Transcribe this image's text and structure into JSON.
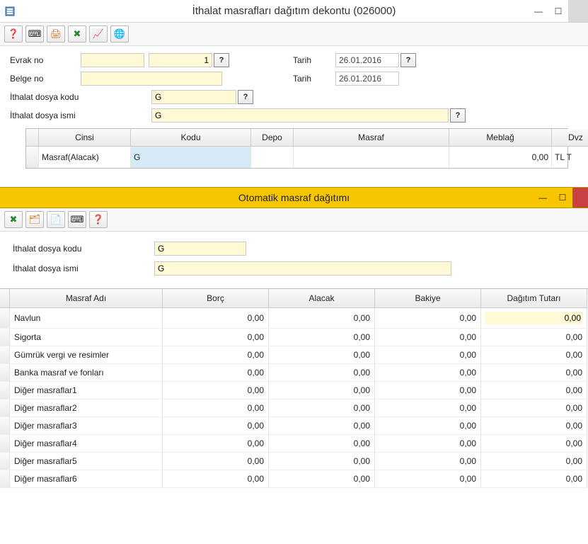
{
  "window": {
    "title": "İthalat masrafları dağıtım dekontu (026000)",
    "minimize": "—",
    "maximize": "☐",
    "close": "✕"
  },
  "toolbar_main": {
    "b1": "❓",
    "b2": "⌨",
    "b3": "🖨",
    "b4": "✖",
    "b5": "📈",
    "b6": "🌐"
  },
  "form": {
    "evrak_no_label": "Evrak no",
    "evrak_no_a": "",
    "evrak_no_b": "1",
    "belge_no_label": "Belge no",
    "belge_no": "",
    "tarih_label": "Tarih",
    "tarih1": "26.01.2016",
    "tarih2": "26.01.2016",
    "dosya_kodu_label": "İthalat dosya kodu",
    "dosya_kodu": "G",
    "dosya_ismi_label": "İthalat dosya ismi",
    "dosya_ismi": "G",
    "help": "?"
  },
  "grid_top": {
    "headers": {
      "cinsi": "Cinsi",
      "kodu": "Kodu",
      "depo": "Depo",
      "masraf": "Masraf",
      "meblag": "Meblağ",
      "dvz": "Dvz"
    },
    "row": {
      "cinsi": "Masraf(Alacak)",
      "kodu": "G",
      "depo": "",
      "masraf": "",
      "meblag": "0,00",
      "dvz": "TL  T"
    }
  },
  "sub_window": {
    "title": "Otomatik masraf dağıtımı",
    "minimize": "—",
    "maximize": "☐"
  },
  "toolbar_sub": {
    "b1": "✖",
    "b2": "🗂",
    "b3": "📄",
    "b4": "⌨",
    "b5": "❓"
  },
  "form2": {
    "dosya_kodu_label": "İthalat dosya kodu",
    "dosya_kodu": "G",
    "dosya_ismi_label": "İthalat dosya ismi",
    "dosya_ismi": "G"
  },
  "grid_dist": {
    "headers": {
      "ad": "Masraf Adı",
      "borc": "Borç",
      "alacak": "Alacak",
      "bakiye": "Bakiye",
      "dagitim": "Dağıtım Tutarı"
    },
    "rows": [
      {
        "ad": "Navlun",
        "borc": "0,00",
        "alacak": "0,00",
        "bakiye": "0,00",
        "dagitim": "0,00"
      },
      {
        "ad": "Sigorta",
        "borc": "0,00",
        "alacak": "0,00",
        "bakiye": "0,00",
        "dagitim": "0,00"
      },
      {
        "ad": "Gümrük vergi ve resimler",
        "borc": "0,00",
        "alacak": "0,00",
        "bakiye": "0,00",
        "dagitim": "0,00"
      },
      {
        "ad": "Banka masraf ve fonları",
        "borc": "0,00",
        "alacak": "0,00",
        "bakiye": "0,00",
        "dagitim": "0,00"
      },
      {
        "ad": "Diğer masraflar1",
        "borc": "0,00",
        "alacak": "0,00",
        "bakiye": "0,00",
        "dagitim": "0,00"
      },
      {
        "ad": "Diğer masraflar2",
        "borc": "0,00",
        "alacak": "0,00",
        "bakiye": "0,00",
        "dagitim": "0,00"
      },
      {
        "ad": "Diğer masraflar3",
        "borc": "0,00",
        "alacak": "0,00",
        "bakiye": "0,00",
        "dagitim": "0,00"
      },
      {
        "ad": "Diğer masraflar4",
        "borc": "0,00",
        "alacak": "0,00",
        "bakiye": "0,00",
        "dagitim": "0,00"
      },
      {
        "ad": "Diğer masraflar5",
        "borc": "0,00",
        "alacak": "0,00",
        "bakiye": "0,00",
        "dagitim": "0,00"
      },
      {
        "ad": "Diğer masraflar6",
        "borc": "0,00",
        "alacak": "0,00",
        "bakiye": "0,00",
        "dagitim": "0,00"
      }
    ]
  }
}
